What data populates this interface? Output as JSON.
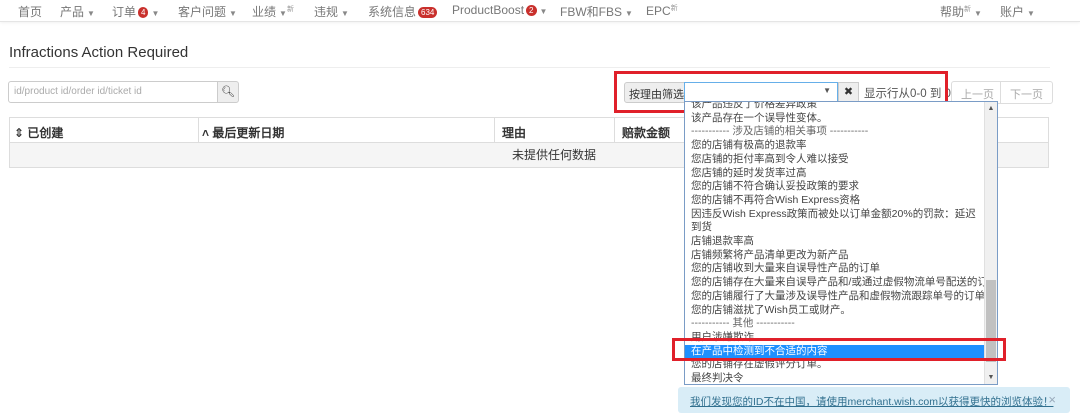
{
  "nav": {
    "items": [
      {
        "label": "首页"
      },
      {
        "label": "产品",
        "caret": true
      },
      {
        "label": "订单",
        "badge": "4",
        "caret": true
      },
      {
        "label": "客户问题",
        "caret": true
      },
      {
        "label": "业绩",
        "caret": true,
        "sup": "新"
      },
      {
        "label": "违规",
        "caret": true
      },
      {
        "label": "系统信息",
        "badge": "634"
      },
      {
        "label": "ProductBoost",
        "badge": "2",
        "caret": true
      },
      {
        "label": "FBW和FBS",
        "caret": true
      },
      {
        "label": "EPC",
        "sup": "新"
      },
      {
        "label": "帮助",
        "sup": "新",
        "caret": true
      },
      {
        "label": "账户",
        "caret": true
      }
    ]
  },
  "page": {
    "title": "Infractions Action Required"
  },
  "search": {
    "placeholder": "id/product id/order id/ticket id"
  },
  "filter": {
    "label": "按理由筛选",
    "value": "",
    "rows_text": "显示行从0-0 到 0",
    "prev": "上一页",
    "next": "下一页"
  },
  "table": {
    "headers": [
      "已创建",
      "最后更新日期",
      "理由",
      "赔款金额"
    ],
    "empty": "未提供任何数据"
  },
  "dropdown": {
    "options": [
      "该产品违反了价格差异政策",
      "该产品存在一个误导性变体。",
      "----------- 涉及店铺的相关事项 -----------",
      "您的店铺有极高的退款率",
      "您店铺的拒付率高到令人难以接受",
      "您店铺的延时发货率过高",
      "您的店铺不符合确认妥投政策的要求",
      "您的店铺不再符合Wish Express资格",
      "因违反Wish Express政策而被处以订单金额20%的罚款：延迟到货",
      "店铺退款率高",
      "店铺频繁将产品清单更改为新产品",
      "您的店铺收到大量来自误导性产品的订单",
      "您的店铺存在大量来自误导产品和/或通过虚假物流单号配送的订单",
      "您的店铺履行了大量涉及误导性产品和虚假物流跟踪单号的订单。",
      "您的店铺滋扰了Wish员工或财产。",
      "----------- 其他 -----------",
      "用户涉嫌欺诈",
      "在产品中检测到不合适的内容",
      "您的店铺存在虚假评分订单。",
      "最终判决令"
    ],
    "highlighted_index": 17
  },
  "notice": {
    "text": "我们发现您的ID不在中国，请使用merchant.wish.com以获得更快的浏览体验！",
    "close": "×"
  }
}
